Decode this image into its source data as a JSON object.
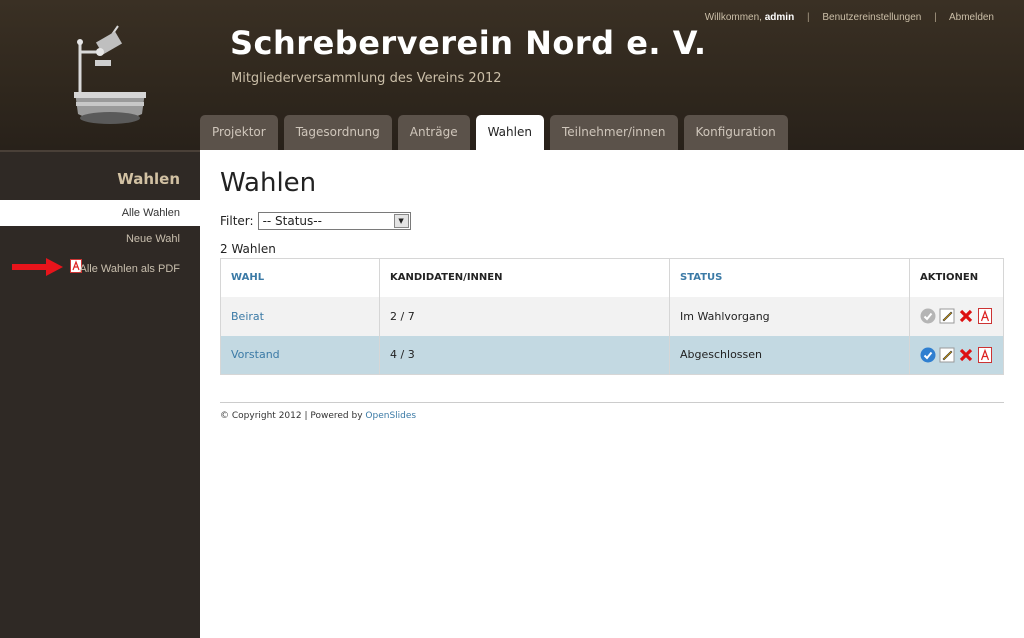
{
  "header": {
    "title": "Schreberverein Nord e. V.",
    "subtitle": "Mitgliederversammlung des Vereins 2012",
    "welcome": "Willkommen,",
    "username": "admin",
    "user_settings": "Benutzereinstellungen",
    "logout": "Abmelden",
    "separator": "|"
  },
  "tabs": [
    {
      "label": "Projektor"
    },
    {
      "label": "Tagesordnung"
    },
    {
      "label": "Anträge"
    },
    {
      "label": "Wahlen"
    },
    {
      "label": "Teilnehmer/innen"
    },
    {
      "label": "Konfiguration"
    }
  ],
  "sidebar": {
    "title": "Wahlen",
    "items": [
      {
        "label": "Alle Wahlen"
      },
      {
        "label": "Neue Wahl"
      },
      {
        "label": "Alle Wahlen als PDF"
      }
    ]
  },
  "main": {
    "title": "Wahlen",
    "filter_label": "Filter:",
    "filter_value": "-- Status--",
    "count": "2 Wahlen",
    "columns": [
      "WAHL",
      "KANDIDATEN/INNEN",
      "STATUS",
      "AKTIONEN"
    ],
    "rows": [
      {
        "wahl": "Beirat",
        "kandidaten": "2 / 7",
        "status": "Im Wahlvorgang"
      },
      {
        "wahl": "Vorstand",
        "kandidaten": "4 / 3",
        "status": "Abgeschlossen"
      }
    ]
  },
  "footer": {
    "text": "© Copyright 2012 | Powered by",
    "link": "OpenSlides"
  },
  "colors": {
    "header_bg": "#2f271d",
    "sidebar_bg": "#2f2925",
    "link": "#3b7aa6",
    "selected_row": "#c3d9e2"
  }
}
